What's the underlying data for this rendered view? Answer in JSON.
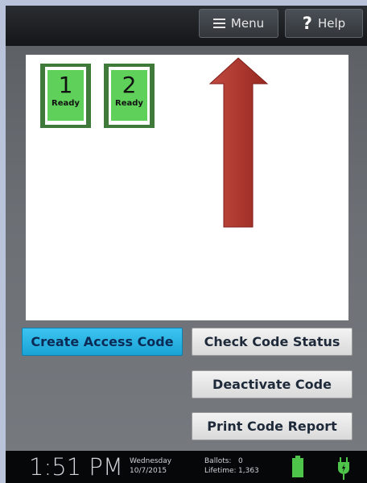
{
  "topbar": {
    "menu_label": "Menu",
    "help_label": "Help",
    "help_glyph": "?"
  },
  "devices": [
    {
      "number": "1",
      "status": "Ready"
    },
    {
      "number": "2",
      "status": "Ready"
    }
  ],
  "actions": {
    "create": "Create Access Code",
    "check": "Check Code Status",
    "deactivate": "Deactivate Code",
    "print": "Print Code Report"
  },
  "statusbar": {
    "time": "1:51 PM",
    "day": "Wednesday",
    "date": "10/7/2015",
    "ballots_label": "Ballots:",
    "ballots_value": "0",
    "lifetime_label": "Lifetime:",
    "lifetime_value": "1,363"
  },
  "icons": [
    "hamburger-menu-icon",
    "help-question-icon",
    "battery-icon",
    "power-plug-icon",
    "up-arrow-annotation"
  ],
  "colors": {
    "accent_blue": "#1aa3d6",
    "ready_green": "#5fd05a",
    "device_frame_green": "#3f7a3a",
    "annotation_arrow": "#a8322b"
  }
}
